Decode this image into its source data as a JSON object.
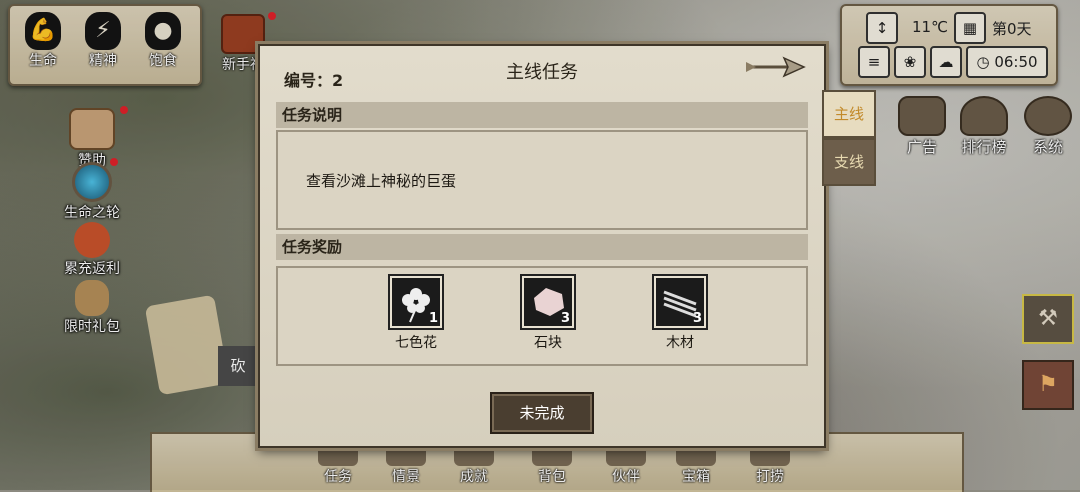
{
  "status": {
    "items": [
      {
        "label": "生命",
        "icon": "life-icon"
      },
      {
        "label": "精神",
        "icon": "spirit-icon"
      },
      {
        "label": "饱食",
        "icon": "food-icon"
      }
    ]
  },
  "left_menu": {
    "newbie": "新手福",
    "items": [
      {
        "label": "赞助",
        "icon": "sponsor-icon"
      },
      {
        "label": "生命之轮",
        "icon": "wheel-of-life-icon"
      },
      {
        "label": "累充返利",
        "icon": "recharge-rebate-icon"
      },
      {
        "label": "限时礼包",
        "icon": "gift-pack-icon"
      }
    ],
    "partial_text": "砍"
  },
  "top_right": {
    "temperature": "11℃",
    "day": "第0天",
    "time": "06:50"
  },
  "right_menu": {
    "items": [
      {
        "label": "广告",
        "icon": "ad-chest-icon"
      },
      {
        "label": "排行榜",
        "icon": "trophy-icon"
      },
      {
        "label": "系统",
        "icon": "gear-icon"
      }
    ]
  },
  "bottom_menu": {
    "items": [
      {
        "label": "任务",
        "icon": "task-icon"
      },
      {
        "label": "情景",
        "icon": "scene-icon"
      },
      {
        "label": "成就",
        "icon": "achievement-icon"
      },
      {
        "label": "背包",
        "icon": "backpack-icon"
      },
      {
        "label": "伙伴",
        "icon": "partner-icon"
      },
      {
        "label": "宝箱",
        "icon": "treasure-icon"
      },
      {
        "label": "打捞",
        "icon": "salvage-icon"
      }
    ]
  },
  "modal": {
    "number": "编号：2",
    "title": "主线任务",
    "section_desc": "任务说明",
    "description": "查看沙滩上神秘的巨蛋",
    "section_reward": "任务奖励",
    "rewards": [
      {
        "name": "七色花",
        "count": "1",
        "icon": "flower-icon"
      },
      {
        "name": "石块",
        "count": "3",
        "icon": "stone-icon"
      },
      {
        "name": "木材",
        "count": "3",
        "icon": "wood-icon"
      }
    ],
    "button": "未完成"
  },
  "tabs": [
    {
      "label": "主线",
      "active": true
    },
    {
      "label": "支线",
      "active": false
    }
  ]
}
